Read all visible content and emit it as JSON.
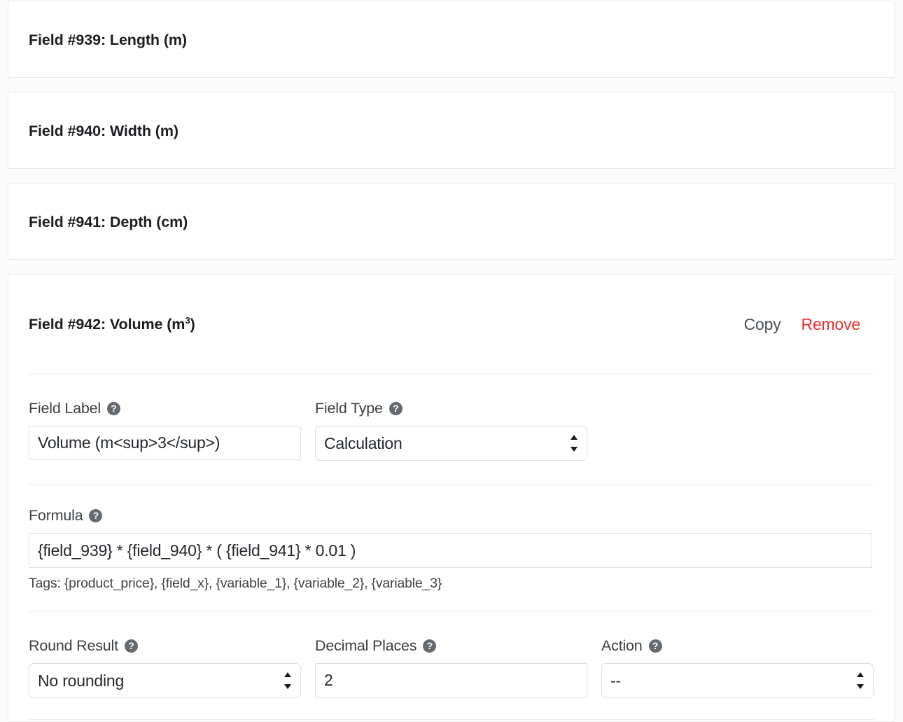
{
  "fields": [
    {
      "title": "Field #939: Length (m)",
      "expanded": false
    },
    {
      "title": "Field #940: Width (m)",
      "expanded": false
    },
    {
      "title": "Field #941: Depth (cm)",
      "expanded": false
    }
  ],
  "expanded_field": {
    "title_prefix": "Field #942: Volume (m",
    "title_sup": "3",
    "title_suffix": ")",
    "actions": {
      "copy_label": "Copy",
      "remove_label": "Remove",
      "copy_color": "#4a4f54",
      "remove_color": "#e8312a"
    },
    "help_icon_glyph": "?",
    "form": {
      "field_label": {
        "label": "Field Label",
        "value": "Volume (m<sup>3</sup>)",
        "placeholder": "Field Label"
      },
      "field_type": {
        "label": "Field Type",
        "value": "Calculation",
        "options": [
          "Calculation"
        ]
      },
      "formula": {
        "label": "Formula",
        "value": "{field_939} * {field_940} * ( {field_941} * 0.01 )",
        "placeholder": "Formula",
        "tags": "Tags: {product_price}, {field_x}, {variable_1}, {variable_2}, {variable_3}"
      },
      "round_result": {
        "label": "Round Result",
        "value": "No rounding",
        "options": [
          "No rounding"
        ]
      },
      "decimal_places": {
        "label": "Decimal Places",
        "value": "2",
        "placeholder": "Decimal Places"
      },
      "action": {
        "label": "Action",
        "value": "--",
        "options": [
          "--"
        ]
      }
    }
  }
}
